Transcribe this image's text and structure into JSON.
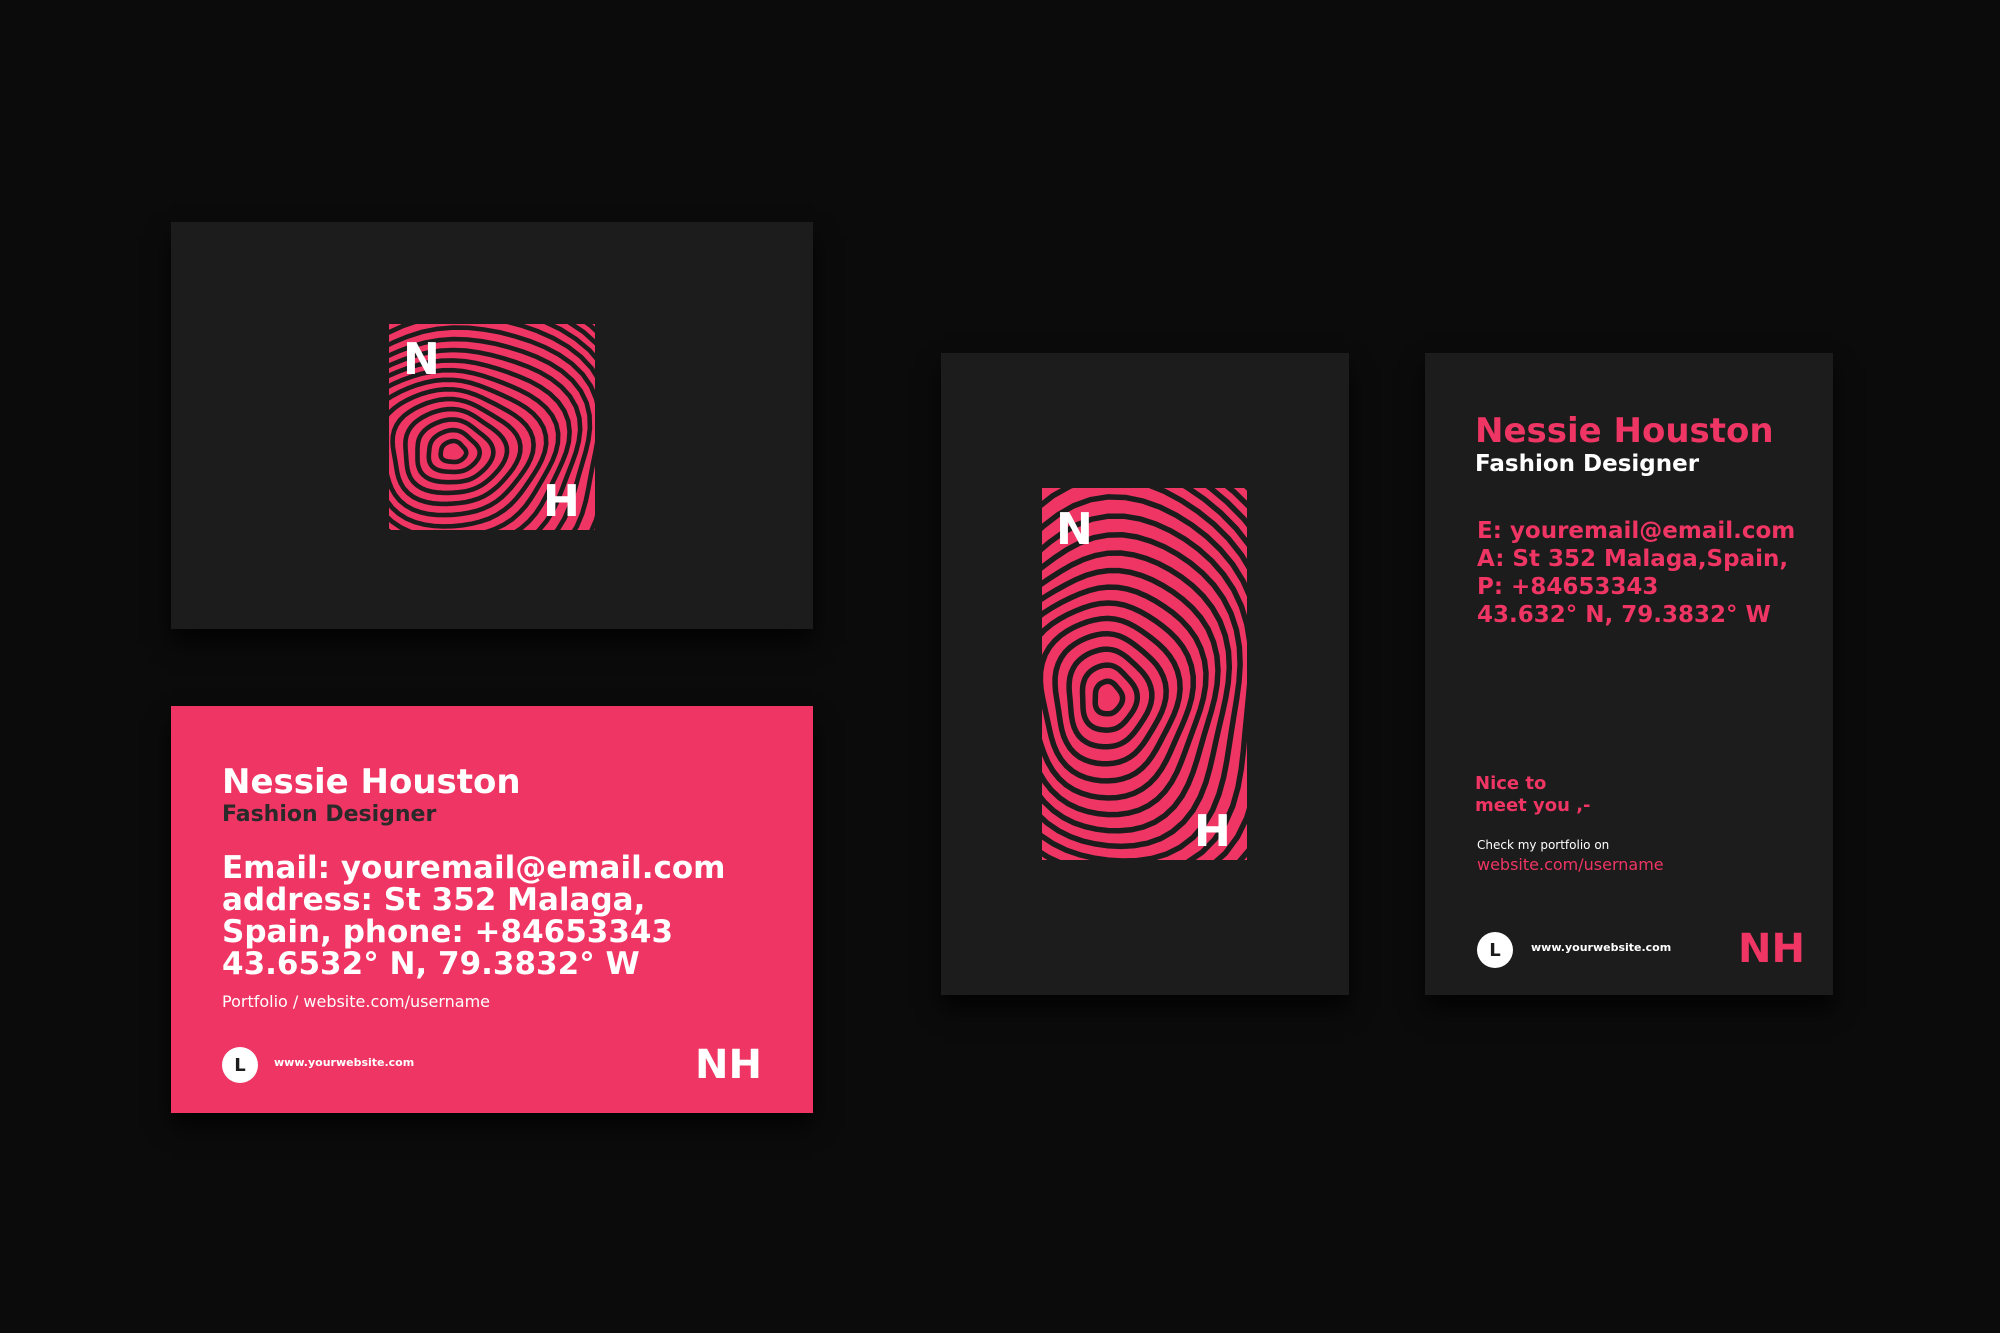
{
  "colors": {
    "background": "#0b0b0b",
    "card_dark": "#1c1c1c",
    "accent": "#ef3563",
    "white": "#ffffff"
  },
  "logo": {
    "letter_top": "N",
    "letter_bottom": "H",
    "pattern": "concentric-wavy-lines"
  },
  "card_back_horizontal": {
    "name": "Nessie Houston",
    "role": "Fashion Designer",
    "contact_lines": [
      "Email: youremail@email.com",
      "address: St 352 Malaga,",
      "Spain, phone: +84653343",
      "43.6532° N, 79.3832° W"
    ],
    "portfolio": "Portfolio / website.com/username",
    "badge_letter": "L",
    "website": "www.yourwebsite.com",
    "monogram": "NH"
  },
  "card_back_vertical": {
    "name": "Nessie Houston",
    "role": "Fashion Designer",
    "contact_lines": [
      "E: youremail@email.com",
      "A: St 352 Malaga,Spain,",
      "P: +84653343",
      "43.632° N, 79.3832° W"
    ],
    "greeting_lines": [
      "Nice to",
      "meet you ,-"
    ],
    "portfolio_label": "Check my portfolio on",
    "portfolio_link": "website.com/username",
    "badge_letter": "L",
    "website": "www.yourwebsite.com",
    "monogram": "NH"
  }
}
